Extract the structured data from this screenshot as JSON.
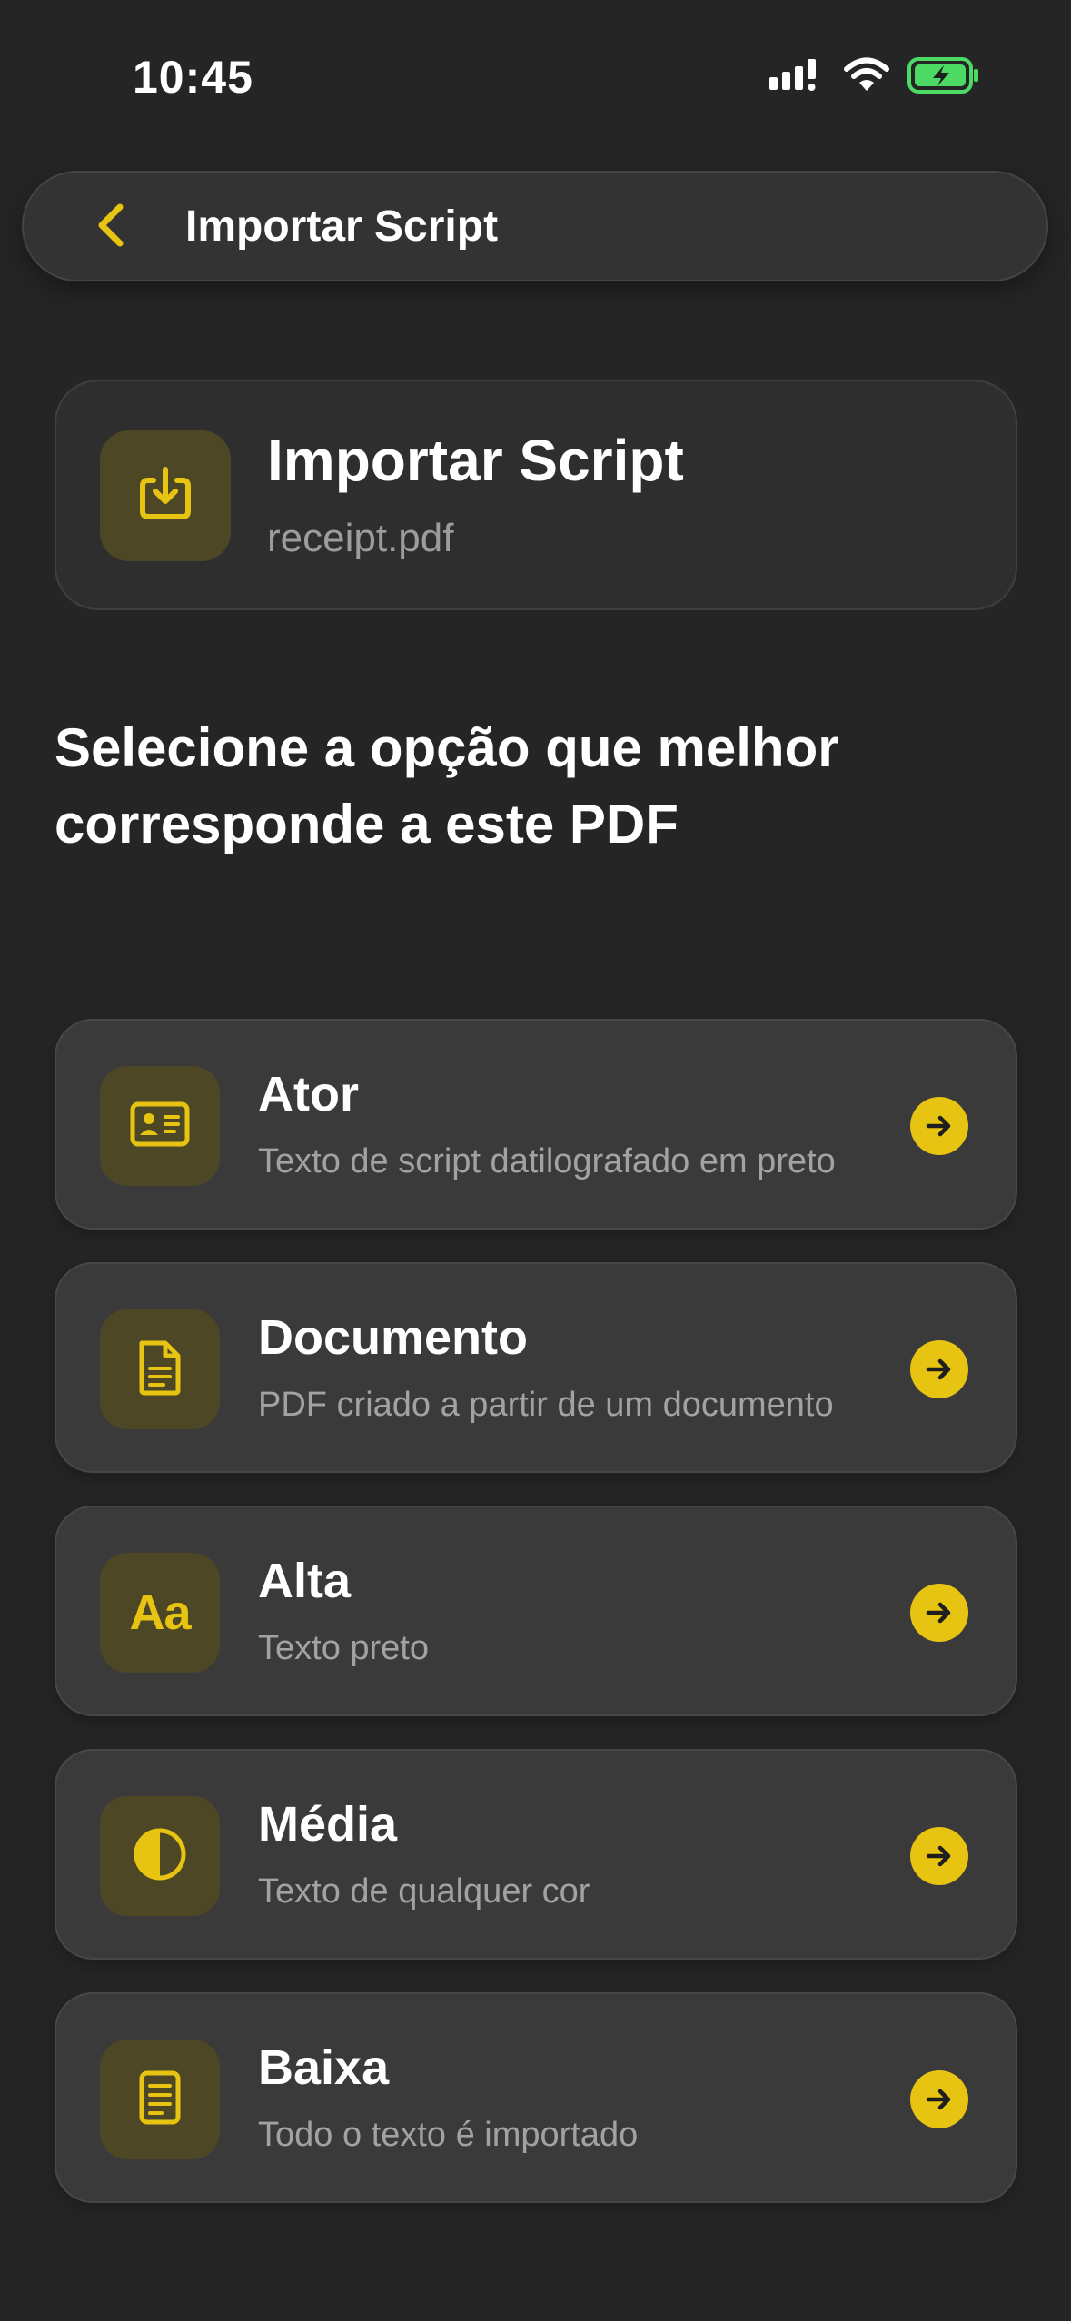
{
  "status_bar": {
    "time": "10:45"
  },
  "nav": {
    "title": "Importar Script",
    "back_icon": "chevron-left-icon"
  },
  "file_card": {
    "title": "Importar Script",
    "filename": "receipt.pdf",
    "icon": "import-icon"
  },
  "prompt": {
    "text": "Selecione a opção que melhor corresponde a este PDF"
  },
  "options": [
    {
      "title": "Ator",
      "description": "Texto de script datilografado em preto",
      "icon": "id-card-icon"
    },
    {
      "title": "Documento",
      "description": "PDF criado a partir de um documento",
      "icon": "document-icon"
    },
    {
      "title": "Alta",
      "description": "Texto preto",
      "icon": "text-aa-icon",
      "glyph": "Aa"
    },
    {
      "title": "Média",
      "description": "Texto de qualquer cor",
      "icon": "contrast-icon"
    },
    {
      "title": "Baixa",
      "description": "Todo o texto é importado",
      "icon": "notes-icon"
    }
  ],
  "colors": {
    "accent": "#e6c411",
    "background": "#252525",
    "card": "#3a3a3a",
    "icon_tile": "#4e4726",
    "battery": "#4cd964"
  }
}
